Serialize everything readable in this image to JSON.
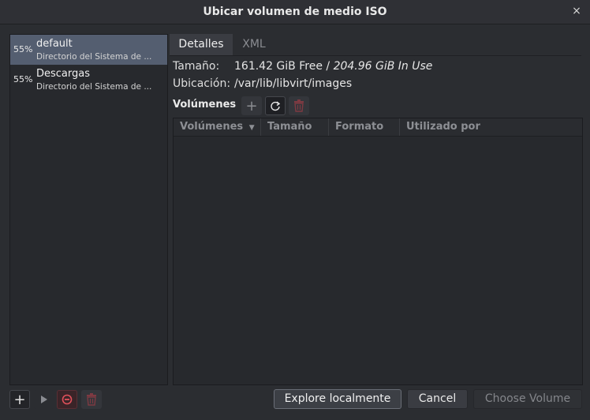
{
  "window": {
    "title": "Ubicar volumen de medio ISO",
    "close_label": "×"
  },
  "pools": [
    {
      "percent": "55%",
      "name": "default",
      "description": "Directorio del Sistema de ..."
    },
    {
      "percent": "55%",
      "name": "Descargas",
      "description": "Directorio del Sistema de ..."
    }
  ],
  "tabs": {
    "details": "Detalles",
    "xml": "XML"
  },
  "details": {
    "size_label": "Tamaño:",
    "size_free": "161.42 GiB Free",
    "size_separator": " / ",
    "size_used": "204.96 GiB In Use",
    "location_label": "Ubicación:",
    "location_value": "/var/lib/libvirt/images"
  },
  "volumes": {
    "header": "Volúmenes",
    "columns": [
      "Volúmenes",
      "Tamaño",
      "Formato",
      "Utilizado por"
    ],
    "sort_indicator": "▼",
    "rows": []
  },
  "buttons": {
    "add_pool": "+",
    "explore": "Explore localmente",
    "cancel": "Cancel",
    "choose": "Choose Volume",
    "add_volume": "+"
  },
  "icons": {
    "close": "close-icon",
    "add": "plus-icon",
    "refresh": "refresh-icon",
    "delete": "trash-icon",
    "play": "play-icon",
    "stop": "stop-icon"
  },
  "colors": {
    "accent_selected": "#545e70",
    "delete_red": "#9a3a44",
    "stop_red": "#e0505a"
  }
}
